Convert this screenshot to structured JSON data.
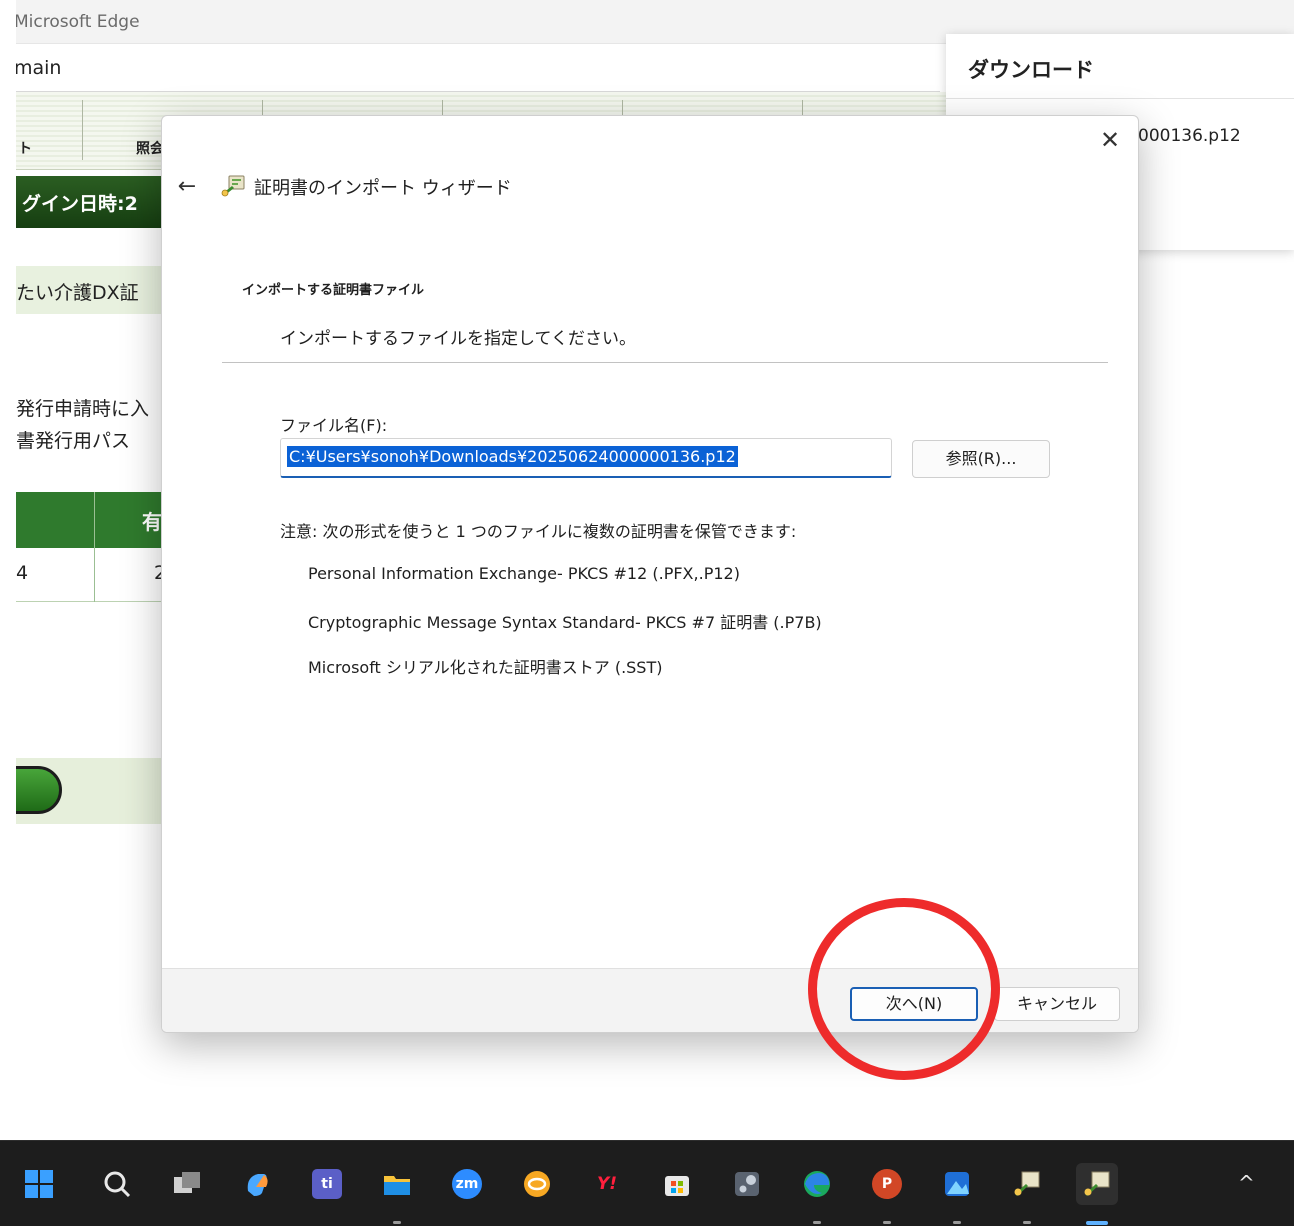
{
  "browser": {
    "title": "Microsoft Edge",
    "address_text": "main",
    "toolbar_labels": [
      "ト",
      "照会"
    ],
    "login_text": "グイン日時:2",
    "section_text": "たい介護DX証",
    "body_lines": [
      "発行申請時に入",
      "書発行用パス"
    ],
    "table_header": [
      "",
      "有"
    ],
    "table_row": [
      "4",
      "2"
    ]
  },
  "downloads": {
    "title": "ダウンロード",
    "file_name": "000136.p12"
  },
  "dialog": {
    "close_glyph": "✕",
    "back_glyph": "←",
    "wizard_title": "証明書のインポート ウィザード",
    "section_title": "インポートする証明書ファイル",
    "section_desc": "インポートするファイルを指定してください。",
    "file_label": "ファイル名(F):",
    "file_value": "C:¥Users¥sonoh¥Downloads¥20250624000000136.p12",
    "browse_label": "参照(R)...",
    "note": "注意: 次の形式を使うと 1 つのファイルに複数の証明書を保管できます:",
    "formats": [
      "Personal Information Exchange- PKCS #12 (.PFX,.P12)",
      "Cryptographic Message Syntax Standard- PKCS #7 証明書 (.P7B)",
      "Microsoft シリアル化された証明書ストア (.SST)"
    ],
    "next_label": "次へ(N)",
    "cancel_label": "キャンセル"
  },
  "annotation": {
    "color": "#ee2b2b"
  },
  "taskbar": {
    "icons": [
      {
        "name": "start-icon",
        "text": ""
      },
      {
        "name": "search-icon",
        "text": ""
      },
      {
        "name": "task-view-icon",
        "text": ""
      },
      {
        "name": "copilot-icon",
        "text": ""
      },
      {
        "name": "teams-icon",
        "text": "ti"
      },
      {
        "name": "file-explorer-icon",
        "text": ""
      },
      {
        "name": "zoom-icon",
        "text": "zm"
      },
      {
        "name": "mail-icon",
        "text": ""
      },
      {
        "name": "yahoo-icon",
        "text": "Y!"
      },
      {
        "name": "store-icon",
        "text": ""
      },
      {
        "name": "settings-icon",
        "text": ""
      },
      {
        "name": "edge-icon",
        "text": ""
      },
      {
        "name": "powerpoint-icon",
        "text": "P"
      },
      {
        "name": "photos-icon",
        "text": ""
      },
      {
        "name": "cert-wizard-icon",
        "text": ""
      },
      {
        "name": "cert-wizard-active-icon",
        "text": ""
      }
    ],
    "tray_chevron": "^"
  }
}
